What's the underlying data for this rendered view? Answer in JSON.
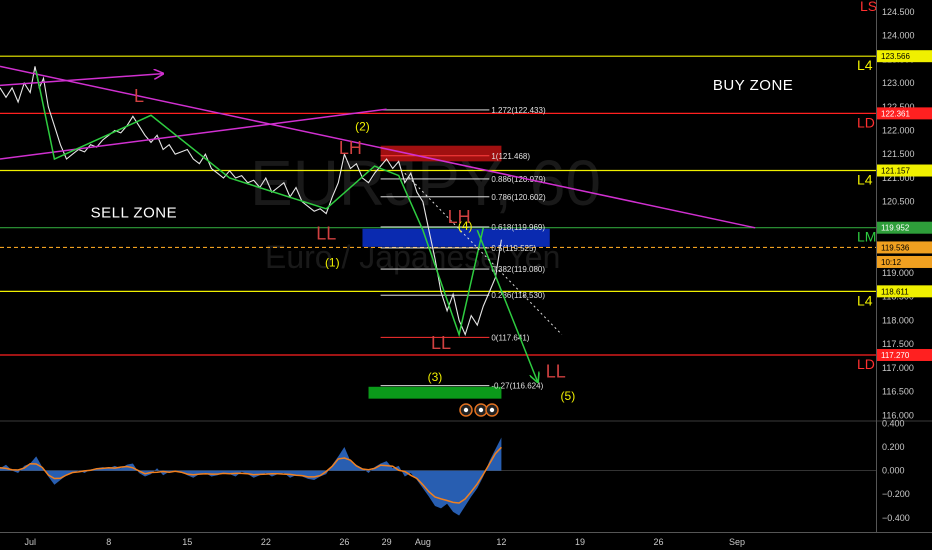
{
  "chart_data": {
    "type": "line",
    "watermark": {
      "symbol": "EURJPY, 60",
      "name": "Euro / Japanese Yen"
    },
    "price_axis": {
      "ylim": [
        115.9,
        124.75
      ],
      "ticks": [
        "124.500",
        "124.000",
        "123.500",
        "123.000",
        "122.500",
        "122.000",
        "121.500",
        "121.000",
        "120.500",
        "120.000",
        "119.500",
        "119.000",
        "118.500",
        "118.000",
        "117.500",
        "117.000",
        "116.500",
        "116.000"
      ]
    },
    "osc_axis": {
      "ylim": [
        -0.52,
        0.42
      ],
      "ticks": [
        "0.400",
        "0.200",
        "0.000",
        "−0.200",
        "−0.400"
      ]
    },
    "x_axis": {
      "ticks": [
        {
          "label": "Jul",
          "x": 0
        },
        {
          "label": "8",
          "x": 13
        },
        {
          "label": "15",
          "x": 26
        },
        {
          "label": "22",
          "x": 39
        },
        {
          "label": "26",
          "x": 52
        },
        {
          "label": "29",
          "x": 59
        },
        {
          "label": "Aug",
          "x": 65
        },
        {
          "label": "12",
          "x": 78
        },
        {
          "label": "19",
          "x": 91
        },
        {
          "label": "26",
          "x": 104
        },
        {
          "label": "Sep",
          "x": 117
        }
      ],
      "xlim": [
        -5,
        140
      ]
    },
    "price_series": [
      [
        -5,
        122.9
      ],
      [
        -4,
        122.7
      ],
      [
        -3,
        122.9
      ],
      [
        -2,
        122.6
      ],
      [
        -1,
        123.0
      ],
      [
        0,
        122.8
      ],
      [
        0.8,
        123.35
      ],
      [
        1.5,
        122.9
      ],
      [
        2.2,
        123.1
      ],
      [
        3,
        122.5
      ],
      [
        4,
        122.1
      ],
      [
        5,
        121.7
      ],
      [
        6,
        121.4
      ],
      [
        7,
        121.5
      ],
      [
        8,
        121.6
      ],
      [
        9,
        121.55
      ],
      [
        10,
        121.7
      ],
      [
        11,
        121.65
      ],
      [
        12,
        121.8
      ],
      [
        13,
        121.9
      ],
      [
        14,
        122.0
      ],
      [
        15,
        121.95
      ],
      [
        16,
        122.1
      ],
      [
        17,
        122.3
      ],
      [
        18,
        122.1
      ],
      [
        19,
        121.9
      ],
      [
        20,
        121.75
      ],
      [
        21,
        121.9
      ],
      [
        22,
        121.6
      ],
      [
        23,
        121.7
      ],
      [
        24,
        121.5
      ],
      [
        25,
        121.55
      ],
      [
        26,
        121.6
      ],
      [
        27,
        121.4
      ],
      [
        28,
        121.3
      ],
      [
        29,
        121.5
      ],
      [
        30,
        121.2
      ],
      [
        31,
        121.1
      ],
      [
        32,
        121.0
      ],
      [
        33,
        121.15
      ],
      [
        34,
        121.0
      ],
      [
        35,
        121.05
      ],
      [
        36,
        120.9
      ],
      [
        37,
        120.95
      ],
      [
        38,
        120.8
      ],
      [
        39,
        121.0
      ],
      [
        40,
        120.7
      ],
      [
        41,
        120.8
      ],
      [
        42,
        120.9
      ],
      [
        43,
        120.6
      ],
      [
        44,
        120.8
      ],
      [
        45,
        120.5
      ],
      [
        46,
        120.4
      ],
      [
        47,
        120.3
      ],
      [
        48,
        120.35
      ],
      [
        49,
        120.25
      ],
      [
        50,
        120.6
      ],
      [
        51,
        120.9
      ],
      [
        52,
        121.5
      ],
      [
        53,
        121.2
      ],
      [
        54,
        121.3
      ],
      [
        55,
        121.0
      ],
      [
        56,
        120.9
      ],
      [
        57,
        121.1
      ],
      [
        58,
        121.25
      ],
      [
        59,
        121.4
      ],
      [
        60,
        121.2
      ],
      [
        61,
        121.35
      ],
      [
        62,
        120.9
      ],
      [
        63,
        121.1
      ],
      [
        64,
        120.7
      ],
      [
        65,
        120.5
      ],
      [
        66,
        119.9
      ],
      [
        67,
        119.3
      ],
      [
        68,
        118.6
      ],
      [
        69,
        118.2
      ],
      [
        70,
        118.55
      ],
      [
        71,
        118.0
      ],
      [
        72,
        117.7
      ],
      [
        73,
        118.1
      ],
      [
        74,
        117.9
      ],
      [
        75,
        118.3
      ],
      [
        76,
        118.6
      ],
      [
        77,
        118.9
      ],
      [
        77.5,
        119.3
      ],
      [
        78,
        119.7
      ]
    ],
    "osc_series": [
      [
        -5,
        0.02
      ],
      [
        -4,
        0.05
      ],
      [
        -3,
        0.0
      ],
      [
        -2,
        -0.02
      ],
      [
        -1,
        0.04
      ],
      [
        0,
        0.06
      ],
      [
        1,
        0.12
      ],
      [
        2,
        0.03
      ],
      [
        3,
        -0.05
      ],
      [
        4,
        -0.12
      ],
      [
        5,
        -0.08
      ],
      [
        6,
        -0.04
      ],
      [
        7,
        -0.02
      ],
      [
        8,
        0.0
      ],
      [
        9,
        -0.02
      ],
      [
        10,
        0.01
      ],
      [
        11,
        0.02
      ],
      [
        12,
        0.03
      ],
      [
        13,
        0.02
      ],
      [
        14,
        0.04
      ],
      [
        15,
        0.02
      ],
      [
        16,
        0.05
      ],
      [
        17,
        0.06
      ],
      [
        18,
        -0.02
      ],
      [
        19,
        -0.05
      ],
      [
        20,
        -0.03
      ],
      [
        21,
        0.02
      ],
      [
        22,
        -0.04
      ],
      [
        23,
        -0.01
      ],
      [
        24,
        0.0
      ],
      [
        25,
        -0.01
      ],
      [
        26,
        -0.04
      ],
      [
        27,
        -0.06
      ],
      [
        28,
        -0.03
      ],
      [
        29,
        -0.02
      ],
      [
        30,
        -0.05
      ],
      [
        31,
        -0.04
      ],
      [
        32,
        -0.02
      ],
      [
        33,
        -0.03
      ],
      [
        34,
        -0.05
      ],
      [
        35,
        -0.01
      ],
      [
        36,
        -0.03
      ],
      [
        37,
        -0.06
      ],
      [
        38,
        -0.04
      ],
      [
        39,
        -0.02
      ],
      [
        40,
        -0.05
      ],
      [
        41,
        -0.03
      ],
      [
        42,
        -0.02
      ],
      [
        43,
        -0.06
      ],
      [
        44,
        -0.04
      ],
      [
        45,
        -0.05
      ],
      [
        46,
        -0.07
      ],
      [
        47,
        -0.08
      ],
      [
        48,
        -0.05
      ],
      [
        49,
        -0.03
      ],
      [
        50,
        0.05
      ],
      [
        51,
        0.12
      ],
      [
        52,
        0.2
      ],
      [
        53,
        0.08
      ],
      [
        54,
        0.05
      ],
      [
        55,
        0.02
      ],
      [
        56,
        -0.02
      ],
      [
        57,
        0.03
      ],
      [
        58,
        0.06
      ],
      [
        59,
        0.08
      ],
      [
        60,
        0.02
      ],
      [
        61,
        0.04
      ],
      [
        62,
        -0.05
      ],
      [
        63,
        -0.02
      ],
      [
        64,
        -0.08
      ],
      [
        65,
        -0.15
      ],
      [
        66,
        -0.22
      ],
      [
        67,
        -0.3
      ],
      [
        68,
        -0.32
      ],
      [
        69,
        -0.28
      ],
      [
        70,
        -0.35
      ],
      [
        71,
        -0.38
      ],
      [
        72,
        -0.3
      ],
      [
        73,
        -0.22
      ],
      [
        74,
        -0.15
      ],
      [
        75,
        -0.05
      ],
      [
        76,
        0.08
      ],
      [
        77,
        0.18
      ],
      [
        78,
        0.28
      ]
    ],
    "right_tags": [
      {
        "price": 123.566,
        "text": "123.566",
        "bg": "#f0f000",
        "fg": "#000000"
      },
      {
        "price": 122.361,
        "text": "122.361",
        "bg": "#ff2020",
        "fg": "#ffffff"
      },
      {
        "price": 121.157,
        "text": "121.157",
        "bg": "#f0f000",
        "fg": "#000000"
      },
      {
        "price": 119.952,
        "text": "119.952",
        "bg": "#2e9e3a",
        "fg": "#ffffff"
      },
      {
        "price": 119.536,
        "text": "119.536",
        "bg": "#f0a020",
        "fg": "#000000"
      },
      {
        "price": 119.23,
        "text": "10:12",
        "bg": "#f0a020",
        "fg": "#000000"
      },
      {
        "price": 118.611,
        "text": "118.611",
        "bg": "#f0f000",
        "fg": "#000000"
      },
      {
        "price": 117.27,
        "text": "117.270",
        "bg": "#ff2020",
        "fg": "#ffffff"
      }
    ],
    "levels": [
      {
        "price": 123.566,
        "color": "#f0f000",
        "label": "L4",
        "label_color": "#f0f000"
      },
      {
        "price": 122.361,
        "color": "#ff2020",
        "label": "LD",
        "label_color": "#ff3030"
      },
      {
        "price": 121.157,
        "color": "#f0f000",
        "label": "L4",
        "label_color": "#f0f000"
      },
      {
        "price": 119.952,
        "color": "#2e9e3a",
        "label": "LM",
        "label_color": "#2ecc40"
      },
      {
        "price": 118.611,
        "color": "#f0f000",
        "label": "L4",
        "label_color": "#f0f000"
      },
      {
        "price": 117.27,
        "color": "#ff2020",
        "label": "LD",
        "label_color": "#ff3030"
      }
    ],
    "dashed_level": {
      "price": 119.536,
      "color": "#f0a020"
    },
    "top_label": {
      "text": "LS",
      "color": "#ff3030"
    },
    "fib_levels": [
      {
        "ratio": "1.272",
        "price": 122.433,
        "text": "1.272(122.433)",
        "color": "#ffffff"
      },
      {
        "ratio": "1",
        "price": 121.468,
        "text": "1(121.468)",
        "color": "#ff4040"
      },
      {
        "ratio": "0.886",
        "price": 120.979,
        "text": "0.886(120.979)",
        "color": "#ffffff"
      },
      {
        "ratio": "0.786",
        "price": 120.602,
        "text": "0.786(120.602)",
        "color": "#ffffff"
      },
      {
        "ratio": "0.618",
        "price": 119.969,
        "text": "0.618(119.969)",
        "color": "#ffffff"
      },
      {
        "ratio": "0.5",
        "price": 119.525,
        "text": "0.5(119.525)",
        "color": "#ffffff"
      },
      {
        "ratio": "0.382",
        "price": 119.08,
        "text": "0.382(119.080)",
        "color": "#ffffff"
      },
      {
        "ratio": "0.236",
        "price": 118.53,
        "text": "0.236(118.530)",
        "color": "#ffffff"
      },
      {
        "ratio": "0",
        "price": 117.641,
        "text": "0(117.641)",
        "color": "#ff3030"
      },
      {
        "ratio": "-0.27",
        "price": 116.624,
        "text": "-0.27(116.624)",
        "color": "#ffffff"
      }
    ],
    "fib_range": [
      58,
      76
    ],
    "zones": [
      {
        "x": [
          58,
          78
        ],
        "y": [
          121.35,
          121.68
        ],
        "color": "#a01010"
      },
      {
        "x": [
          55,
          86
        ],
        "y": [
          119.55,
          119.93
        ],
        "color": "#0a2ab0"
      },
      {
        "x": [
          56,
          78
        ],
        "y": [
          116.35,
          116.6
        ],
        "color": "#0b9a1a"
      }
    ],
    "trend_lines": [
      {
        "points": [
          [
            -5,
            123.35
          ],
          [
            120,
            119.95
          ]
        ],
        "color": "#d030d0"
      },
      {
        "points": [
          [
            -5,
            121.4
          ],
          [
            59,
            122.45
          ]
        ],
        "color": "#d030d0"
      },
      {
        "points": [
          [
            -5,
            122.95
          ],
          [
            22,
            123.2
          ]
        ],
        "color": "#d030d0",
        "arrow": true
      },
      {
        "points": [
          [
            1,
            123.25
          ],
          [
            4,
            121.4
          ],
          [
            20,
            122.32
          ],
          [
            33,
            121.0
          ],
          [
            49,
            120.35
          ],
          [
            57,
            121.25
          ],
          [
            61,
            121.05
          ],
          [
            65,
            119.9
          ],
          [
            71,
            117.7
          ],
          [
            75,
            119.95
          ]
        ],
        "color": "#2ecc40"
      },
      {
        "points": [
          [
            74,
            119.9
          ],
          [
            84,
            116.7
          ]
        ],
        "color": "#2ecc40",
        "arrow": true
      },
      {
        "points": [
          [
            62,
            121.1
          ],
          [
            88,
            117.7
          ]
        ],
        "color": "#dddddd",
        "dash": true
      }
    ],
    "wave_labels": [
      {
        "text": "L",
        "x": 18,
        "price": 122.6,
        "color": "#d04040",
        "size": 18
      },
      {
        "text": "LH",
        "x": 53,
        "price": 121.5,
        "color": "#d04040",
        "size": 18
      },
      {
        "text": "LL",
        "x": 49,
        "price": 119.7,
        "color": "#d04040",
        "size": 18
      },
      {
        "text": "LH",
        "x": 71,
        "price": 120.05,
        "color": "#d04040",
        "size": 18
      },
      {
        "text": "LL",
        "x": 68,
        "price": 117.4,
        "color": "#d04040",
        "size": 18
      },
      {
        "text": "LL",
        "x": 87,
        "price": 116.8,
        "color": "#d04040",
        "size": 18
      },
      {
        "text": "(2)",
        "x": 55,
        "price": 122.0,
        "color": "#f0f000",
        "size": 12
      },
      {
        "text": "(1)",
        "x": 50,
        "price": 119.13,
        "color": "#f0f000",
        "size": 12
      },
      {
        "text": "(4)",
        "x": 72,
        "price": 119.9,
        "color": "#f0f000",
        "size": 12
      },
      {
        "text": "(3)",
        "x": 67,
        "price": 116.72,
        "color": "#f0f000",
        "size": 12
      },
      {
        "text": "(5)",
        "x": 89,
        "price": 116.32,
        "color": "#f0f000",
        "size": 12
      }
    ],
    "zone_texts": [
      {
        "text": "BUY ZONE",
        "x": 113,
        "price": 122.85,
        "color": "#ffffff",
        "size": 15
      },
      {
        "text": "SELL  ZONE",
        "x": 10,
        "price": 120.17,
        "color": "#ffffff",
        "size": 15
      }
    ]
  }
}
